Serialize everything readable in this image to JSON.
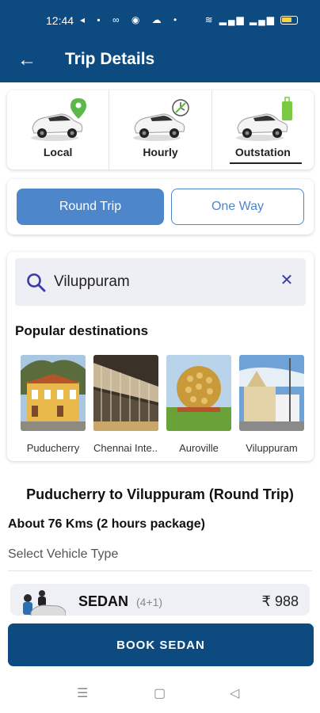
{
  "status_bar": {
    "time": "12:44"
  },
  "app_bar": {
    "title": "Trip Details"
  },
  "trip_types": [
    {
      "label": "Local"
    },
    {
      "label": "Hourly"
    },
    {
      "label": "Outstation"
    }
  ],
  "trip_mode": {
    "round_trip": "Round Trip",
    "one_way": "One Way"
  },
  "search": {
    "value": "Viluppuram"
  },
  "popular": {
    "title": "Popular destinations",
    "items": [
      {
        "label": "Puducherry"
      },
      {
        "label": "Chennai Inte..."
      },
      {
        "label": "Auroville"
      },
      {
        "label": "Viluppuram"
      }
    ]
  },
  "route": {
    "title": "Puducherry to Viluppuram (Round Trip)",
    "distance": "About 76 Kms (2 hours package)",
    "select_vehicle_label": "Select Vehicle Type"
  },
  "vehicle": {
    "name": "SEDAN",
    "seats": "(4+1)",
    "price": "₹ 988"
  },
  "book_button": "BOOK SEDAN",
  "colors": {
    "primary": "#0d4a80",
    "accent": "#4e86cb"
  }
}
